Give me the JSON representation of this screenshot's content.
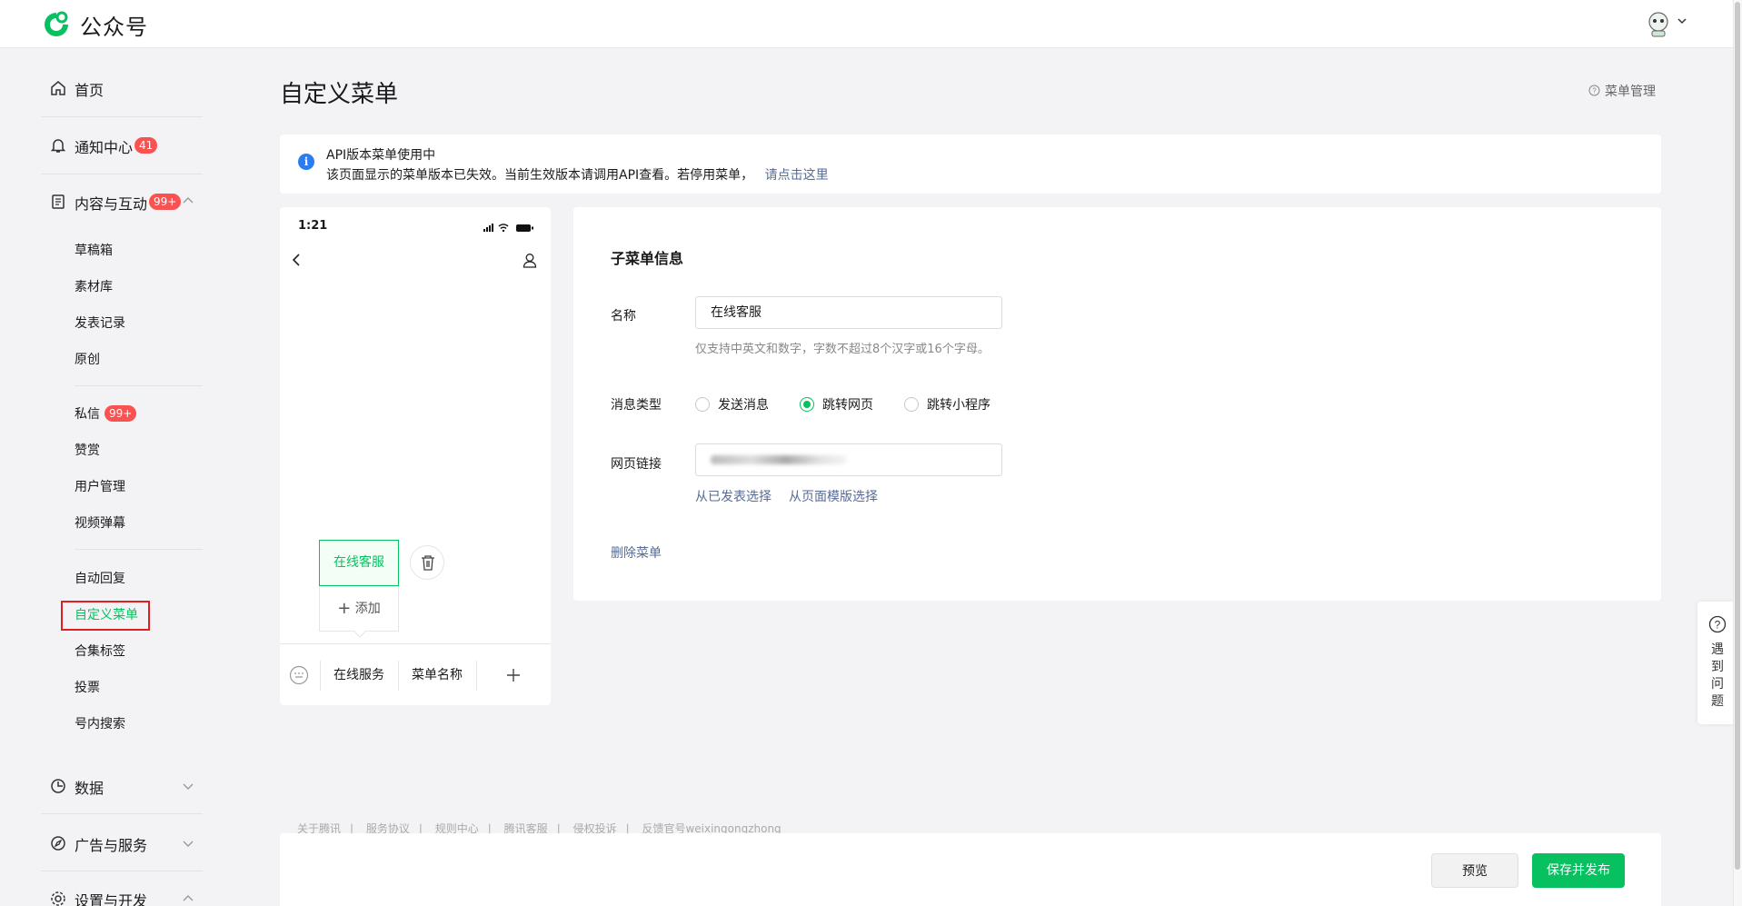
{
  "header": {
    "logo_text": "公众号",
    "avatar_icon": "robot-avatar-icon"
  },
  "sidebar": {
    "home": "首页",
    "notifications": {
      "label": "通知中心",
      "badge": "41"
    },
    "content": {
      "label": "内容与互动",
      "badge": "99+"
    },
    "content_items": [
      "草稿箱",
      "素材库",
      "发表记录",
      "原创"
    ],
    "messages": {
      "label": "私信",
      "badge": "99+"
    },
    "interaction_items": [
      "赞赏",
      "用户管理",
      "视频弹幕"
    ],
    "feature_items": [
      "自动回复",
      "自定义菜单",
      "合集标签",
      "投票",
      "号内搜索"
    ],
    "active_item": "自定义菜单",
    "data": "数据",
    "ads": "广告与服务",
    "settings": "设置与开发"
  },
  "page": {
    "title": "自定义菜单",
    "menu_manage": "菜单管理"
  },
  "notice": {
    "title": "API版本菜单使用中",
    "text": "该页面显示的菜单版本已失效。当前生效版本请调用API查看。若停用菜单，",
    "link": "请点击这里"
  },
  "phone": {
    "time": "1:21",
    "submenu_item": "在线客服",
    "add_label": "添加",
    "tabs": [
      "在线服务",
      "菜单名称"
    ]
  },
  "form": {
    "title": "子菜单信息",
    "name_label": "名称",
    "name_value": "在线客服",
    "name_hint": "仅支持中英文和数字，字数不超过8个汉字或16个字母。",
    "type_label": "消息类型",
    "type_options": [
      "发送消息",
      "跳转网页",
      "跳转小程序"
    ],
    "type_selected": "跳转网页",
    "url_label": "网页链接",
    "url_links": [
      "从已发表选择",
      "从页面模版选择"
    ],
    "delete_label": "删除菜单"
  },
  "footer": {
    "links": [
      "关于腾讯",
      "服务协议",
      "规则中心",
      "腾讯客服",
      "侵权投诉",
      "反馈官号weixingongzhong"
    ],
    "preview_label": "预览",
    "save_label": "保存并发布"
  },
  "help": {
    "label": "遇到问题"
  },
  "colors": {
    "brand_green": "#07c160",
    "link_blue": "#576b95",
    "badge_red": "#fa5151",
    "info_blue": "#2b7cf0"
  }
}
